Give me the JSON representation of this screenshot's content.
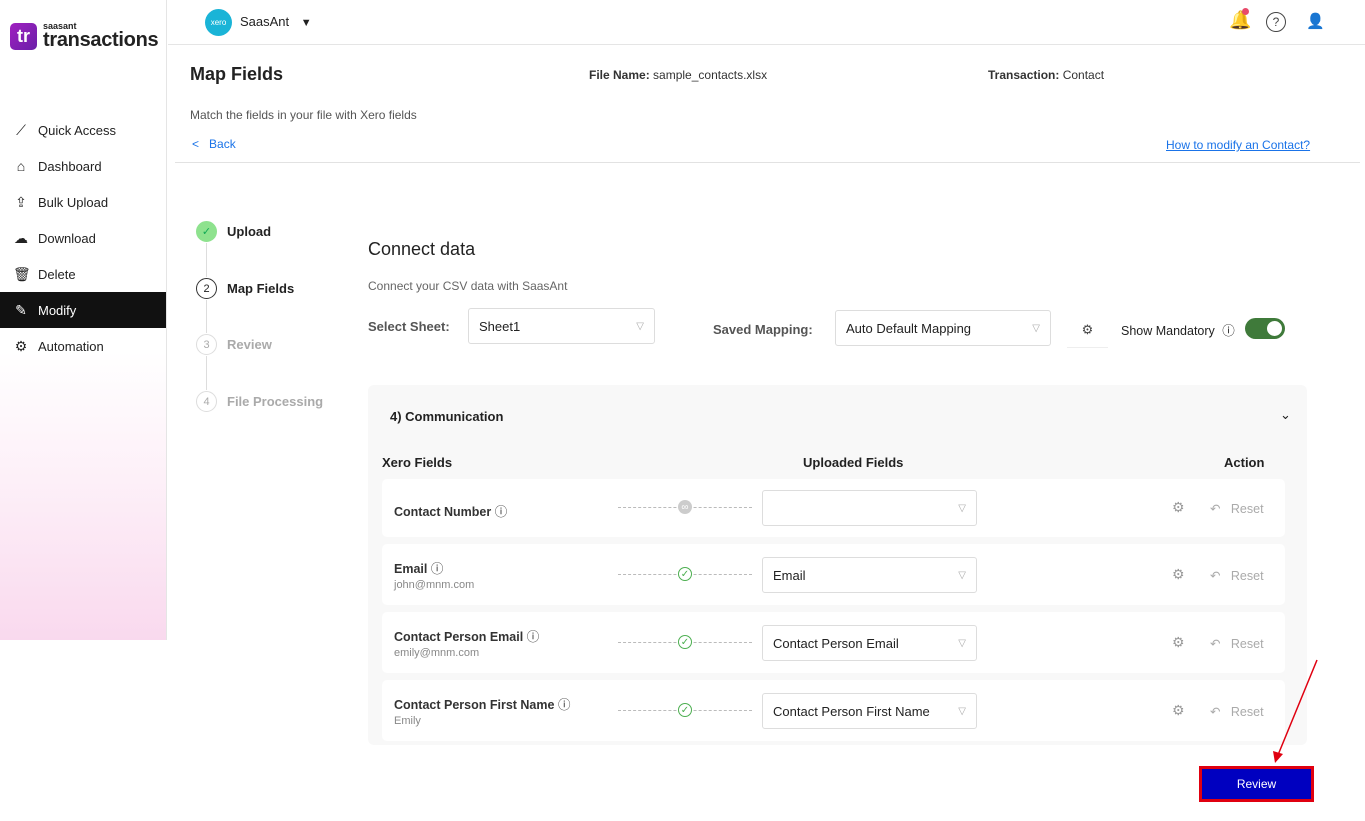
{
  "brand": {
    "small": "saasant",
    "big": "transactions",
    "mark": "tr"
  },
  "nav": [
    {
      "label": "Quick Access",
      "icon": "chart-line-icon"
    },
    {
      "label": "Dashboard",
      "icon": "home-icon"
    },
    {
      "label": "Bulk Upload",
      "icon": "upload-icon"
    },
    {
      "label": "Download",
      "icon": "cloud-download-icon"
    },
    {
      "label": "Delete",
      "icon": "trash-icon"
    },
    {
      "label": "Modify",
      "icon": "edit-icon"
    },
    {
      "label": "Automation",
      "icon": "gears-icon"
    }
  ],
  "header": {
    "xero": "xero",
    "org": "SaasAnt"
  },
  "page": {
    "title": "Map Fields",
    "file_label": "File Name:",
    "file_name": "sample_contacts.xlsx",
    "txn_label": "Transaction:",
    "txn": "Contact",
    "subtitle": "Match the fields in your file with Xero fields",
    "back": "Back",
    "howto": "How to modify an Contact?"
  },
  "steps": [
    {
      "num": "✓",
      "label": "Upload"
    },
    {
      "num": "2",
      "label": "Map Fields"
    },
    {
      "num": "3",
      "label": "Review"
    },
    {
      "num": "4",
      "label": "File Processing"
    }
  ],
  "connect": {
    "title": "Connect data",
    "desc": "Connect your CSV data with SaasAnt",
    "sheet_label": "Select Sheet:",
    "sheet": "Sheet1",
    "mapping_label": "Saved Mapping:",
    "mapping": "Auto Default Mapping",
    "mandatory": "Show Mandatory",
    "mandatory_on": true
  },
  "section": {
    "title": "4) Communication",
    "col_xero": "Xero Fields",
    "col_uploaded": "Uploaded Fields",
    "col_action": "Action",
    "reset": "Reset"
  },
  "rows": [
    {
      "name": "Contact Number",
      "example": "",
      "value": ""
    },
    {
      "name": "Email",
      "example": "john@mnm.com",
      "value": "Email"
    },
    {
      "name": "Contact Person Email",
      "example": "emily@mnm.com",
      "value": "Contact Person Email"
    },
    {
      "name": "Contact Person First Name",
      "example": "Emily",
      "value": "Contact Person First Name"
    }
  ],
  "review_button": "Review"
}
